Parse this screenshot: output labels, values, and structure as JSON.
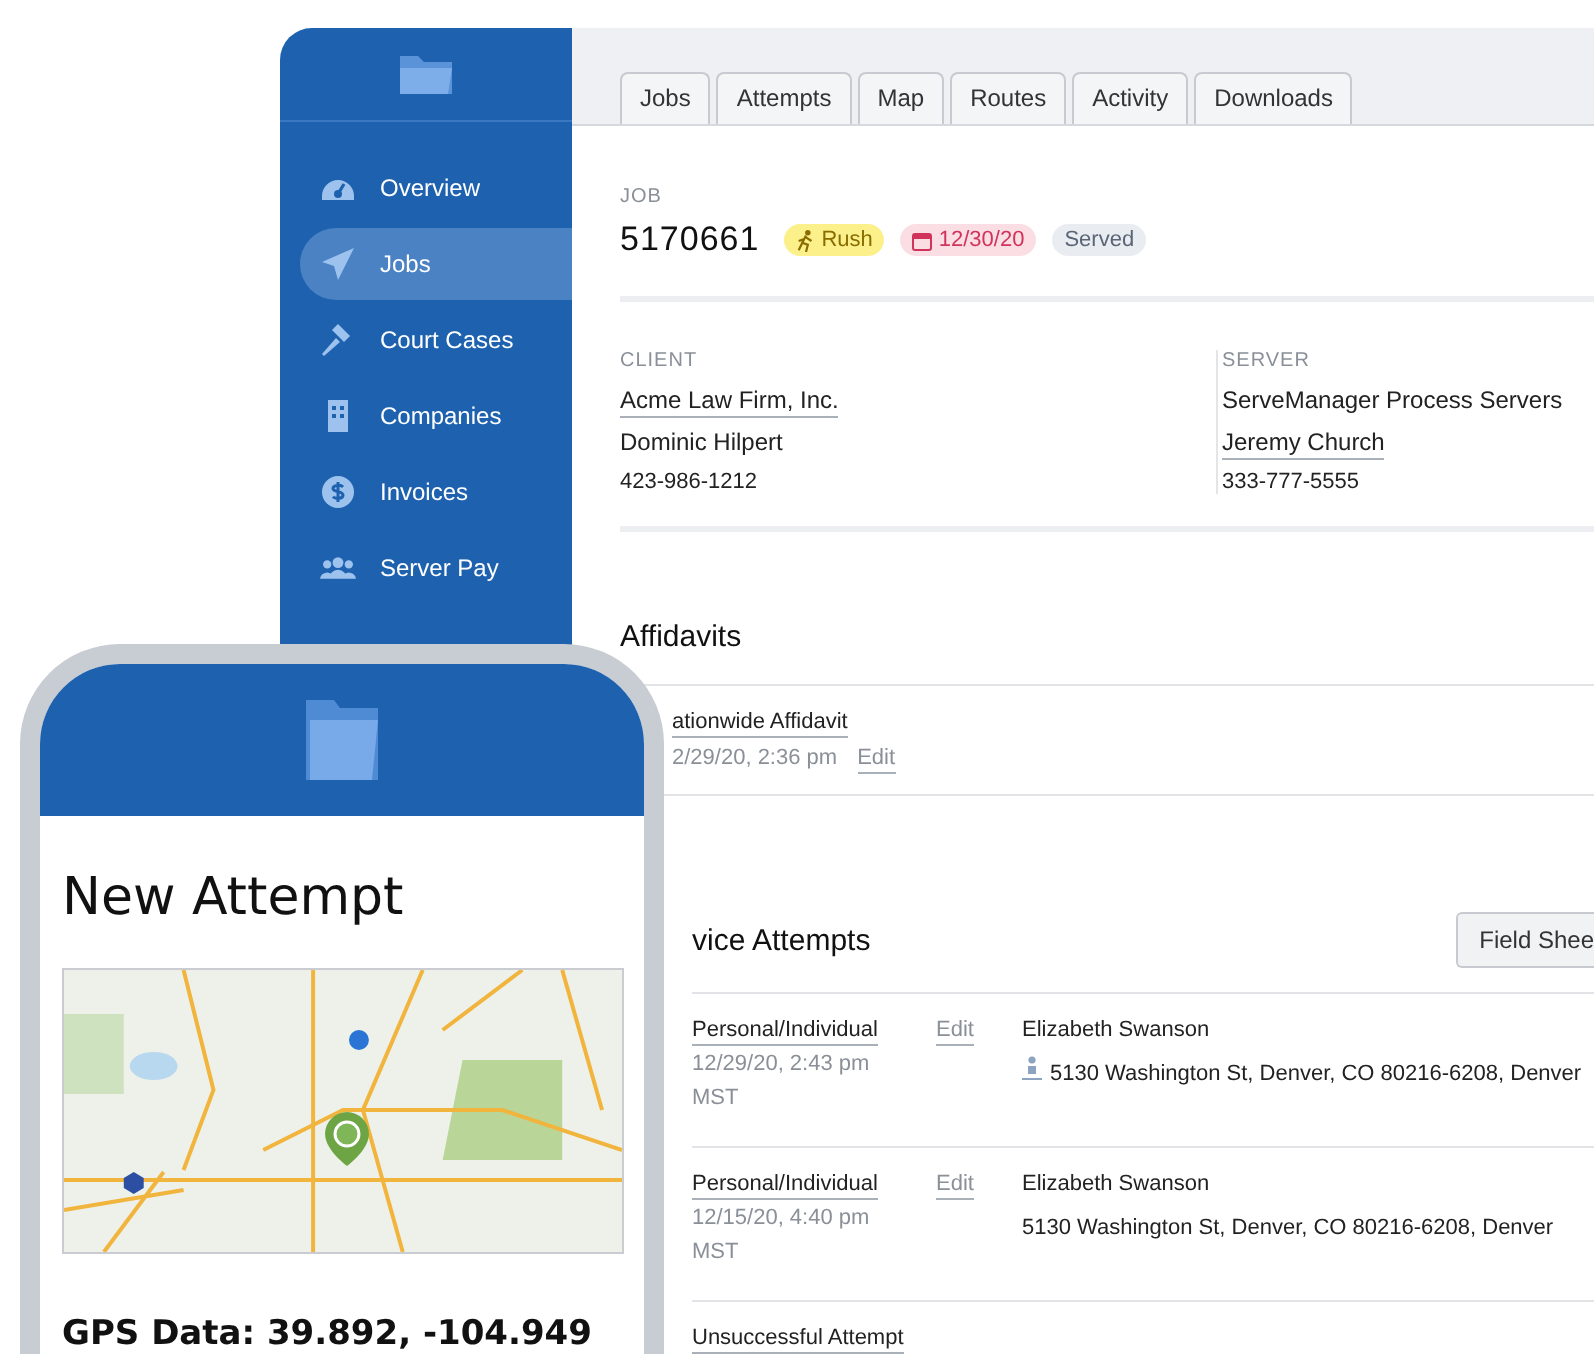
{
  "sidebar": {
    "items": [
      {
        "label": "Overview",
        "selected": false
      },
      {
        "label": "Jobs",
        "selected": true
      },
      {
        "label": "Court Cases",
        "selected": false
      },
      {
        "label": "Companies",
        "selected": false
      },
      {
        "label": "Invoices",
        "selected": false
      },
      {
        "label": "Server Pay",
        "selected": false
      }
    ]
  },
  "tabs": [
    {
      "label": "Jobs"
    },
    {
      "label": "Attempts"
    },
    {
      "label": "Map"
    },
    {
      "label": "Routes"
    },
    {
      "label": "Activity"
    },
    {
      "label": "Downloads"
    }
  ],
  "job": {
    "heading": "JOB",
    "number": "5170661",
    "badges": [
      {
        "kind": "rush",
        "label": "Rush"
      },
      {
        "kind": "date",
        "label": "12/30/20"
      },
      {
        "kind": "status",
        "label": "Served"
      }
    ]
  },
  "client": {
    "heading": "CLIENT",
    "company": "Acme Law Firm, Inc.",
    "contact": "Dominic Hilpert",
    "phone": "423-986-1212"
  },
  "server": {
    "heading": "SERVER",
    "company": "ServeManager Process Servers",
    "contact": "Jeremy Church",
    "phone": "333-777-5555"
  },
  "affidavits": {
    "title": "Affidavits",
    "items": [
      {
        "name": "ationwide Affidavit",
        "date": "2/29/20, 2:36 pm",
        "action": "Edit"
      }
    ]
  },
  "service_attempts": {
    "title": "vice Attempts",
    "button": "Field Shee",
    "rows": [
      {
        "type": "Personal/Individual",
        "date": "12/29/20, 2:43 pm",
        "zone": "MST",
        "action": "Edit",
        "recipient": "Elizabeth Swanson",
        "address": "5130 Washington St, Denver, CO 80216-6208, Denver",
        "geo": true
      },
      {
        "type": "Personal/Individual",
        "date": "12/15/20, 4:40 pm",
        "zone": "MST",
        "action": "Edit",
        "recipient": "Elizabeth Swanson",
        "address": "5130 Washington St, Denver, CO 80216-6208, Denver",
        "geo": false
      },
      {
        "type": "Unsuccessful Attempt"
      }
    ]
  },
  "phone": {
    "title": "New Attempt",
    "gps": "GPS Data: 39.892, -104.949"
  }
}
